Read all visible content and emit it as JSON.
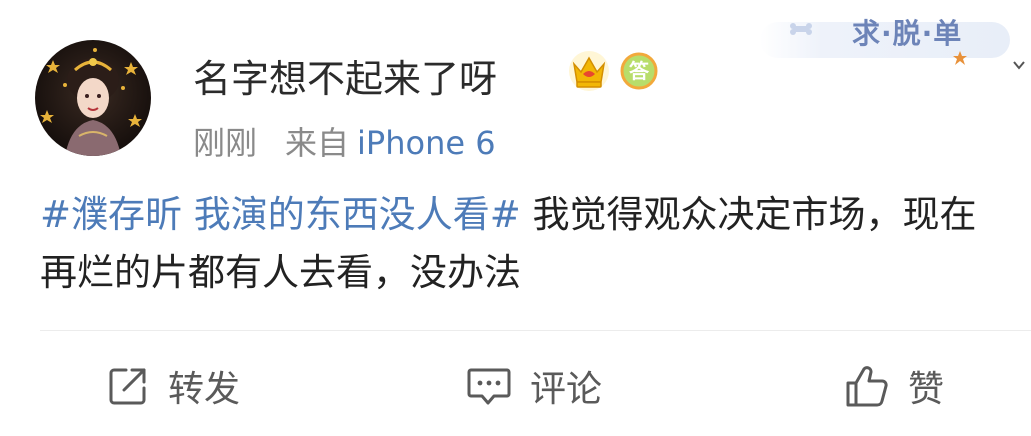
{
  "decoration": {
    "corner_text": "求·脱·单"
  },
  "post": {
    "username": "名字想不起来了呀",
    "badges": [
      "crown-badge-icon",
      "answer-badge-icon"
    ],
    "badge_answer_text": "答",
    "time": "刚刚",
    "source_prefix": "来自",
    "source_device": "iPhone 6",
    "hashtag": "#濮存昕 我演的东西没人看#",
    "body_text": " 我觉得观众决定市场，现在再烂的片都有人去看，没办法"
  },
  "actions": {
    "repost_label": "转发",
    "comment_label": "评论",
    "like_label": "赞"
  },
  "colors": {
    "link_blue": "#4d7bb8",
    "meta_gray": "#8a8a8a",
    "text_dark": "#222222",
    "badge_gold": "#f2b705",
    "badge_green": "#8cc63f"
  }
}
